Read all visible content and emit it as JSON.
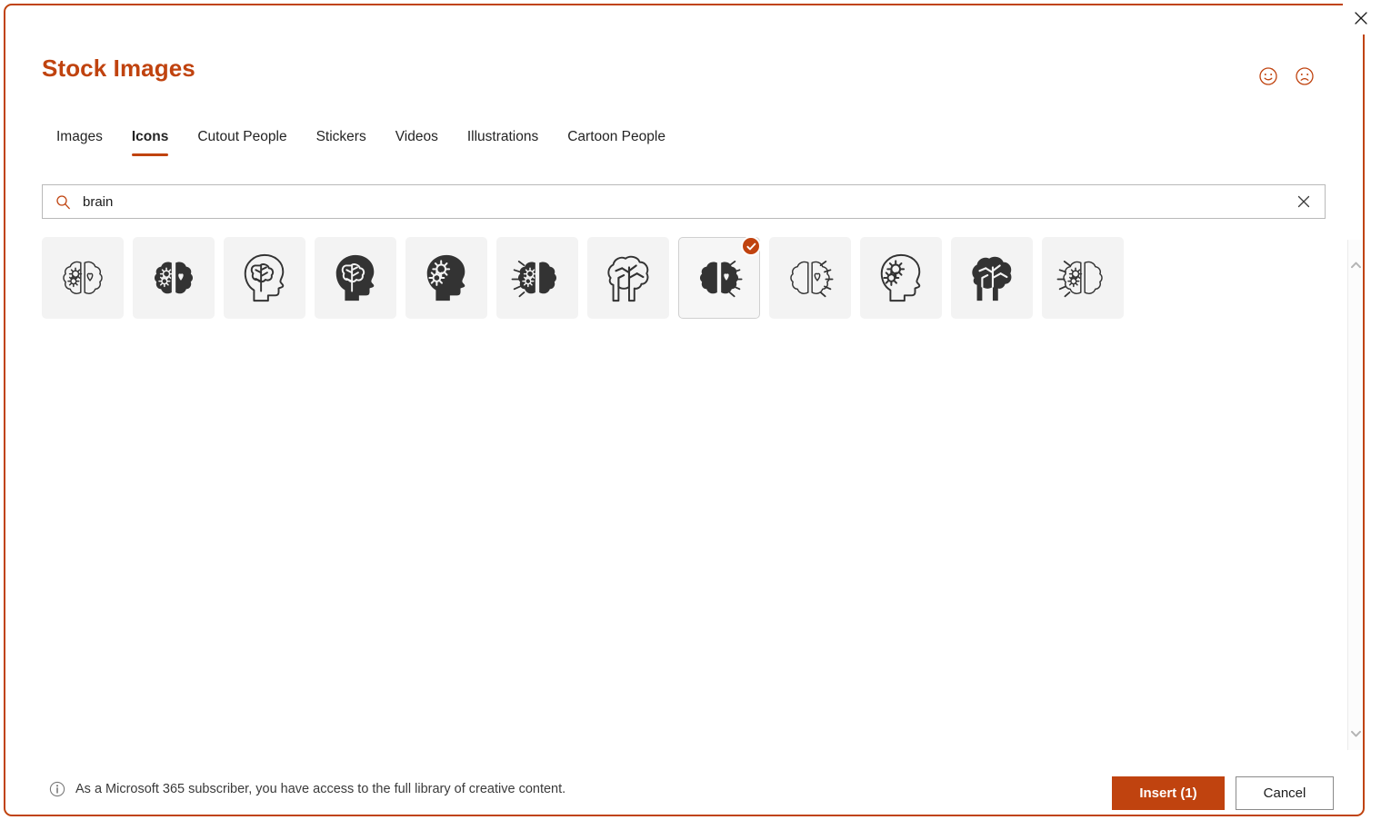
{
  "dialog": {
    "title": "Stock Images",
    "accent_color": "#C0430F",
    "close_icon": "close-icon"
  },
  "header": {
    "feedback_happy_icon": "smiley-happy-icon",
    "feedback_sad_icon": "smiley-sad-icon"
  },
  "tabs": [
    {
      "label": "Images",
      "active": false
    },
    {
      "label": "Icons",
      "active": true
    },
    {
      "label": "Cutout People",
      "active": false
    },
    {
      "label": "Stickers",
      "active": false
    },
    {
      "label": "Videos",
      "active": false
    },
    {
      "label": "Illustrations",
      "active": false
    },
    {
      "label": "Cartoon People",
      "active": false
    }
  ],
  "search": {
    "value": "brain",
    "placeholder": "Search",
    "search_icon": "search-icon",
    "clear_icon": "clear-icon"
  },
  "results": {
    "count": 12,
    "items": [
      {
        "name": "brain-gears-heart-outline",
        "art": "brain-split-outline-gears-heart",
        "selected": false
      },
      {
        "name": "brain-gears-heart-filled",
        "art": "brain-split-filled-gears-heart",
        "selected": false
      },
      {
        "name": "head-brain-outline",
        "art": "head-brain-outline",
        "selected": false
      },
      {
        "name": "head-brain-filled",
        "art": "head-brain-filled",
        "selected": false
      },
      {
        "name": "head-gears-filled",
        "art": "head-gears-filled",
        "selected": false
      },
      {
        "name": "brain-gears-rays-filled",
        "art": "brain-split-filled-gears-rays",
        "selected": false
      },
      {
        "name": "brain-side-outline",
        "art": "brain-side-outline",
        "selected": false
      },
      {
        "name": "brain-heart-rays-filled",
        "art": "brain-split-filled-heart-rays",
        "selected": true
      },
      {
        "name": "brain-heart-rays-outline",
        "art": "brain-split-outline-heart-rays",
        "selected": false
      },
      {
        "name": "head-gears-outline",
        "art": "head-gears-outline",
        "selected": false
      },
      {
        "name": "brain-side-filled",
        "art": "brain-side-filled",
        "selected": false
      },
      {
        "name": "brain-gears-rays-outline",
        "art": "brain-split-outline-gears-rays",
        "selected": false
      }
    ]
  },
  "scrollbar": {
    "up_icon": "chevron-up-icon",
    "down_icon": "chevron-down-icon"
  },
  "footer": {
    "info_icon": "info-icon",
    "note": "As a Microsoft 365 subscriber, you have access to the full library of creative content.",
    "insert_label": "Insert (1)",
    "cancel_label": "Cancel"
  }
}
